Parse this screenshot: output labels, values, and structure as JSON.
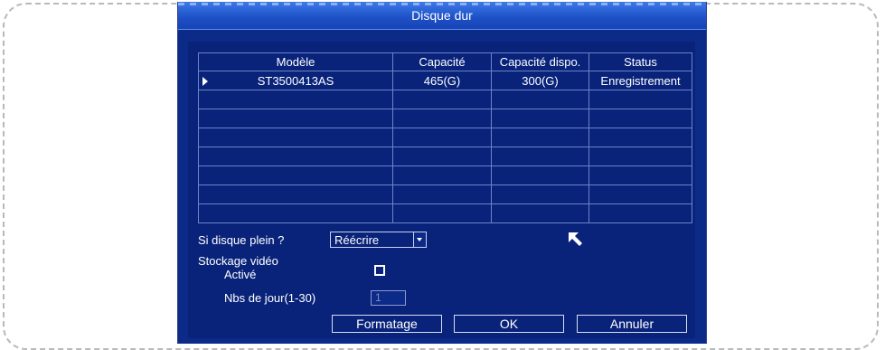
{
  "window": {
    "title": "Disque dur"
  },
  "disk_table": {
    "columns": [
      "Modèle",
      "Capacité",
      "Capacité dispo.",
      "Status"
    ],
    "rows": [
      [
        "ST3500413AS",
        "465(G)",
        "300(G)",
        "Enregistrement"
      ]
    ]
  },
  "settings": {
    "disk_full_label": "Si disque plein ?",
    "disk_full_value": "Réécrire",
    "storage_label": "Stockage vidéo",
    "enabled_label": "Activé",
    "days_label": "Nbs de jour(1-30)",
    "days_value": "1"
  },
  "buttons": {
    "format_label": "Formatage",
    "ok_label": "OK",
    "cancel_label": "Annuler"
  },
  "colors": {
    "window_bg": "#0c2a88",
    "title_bar": "#1d4fc6",
    "text": "#ffffff"
  }
}
